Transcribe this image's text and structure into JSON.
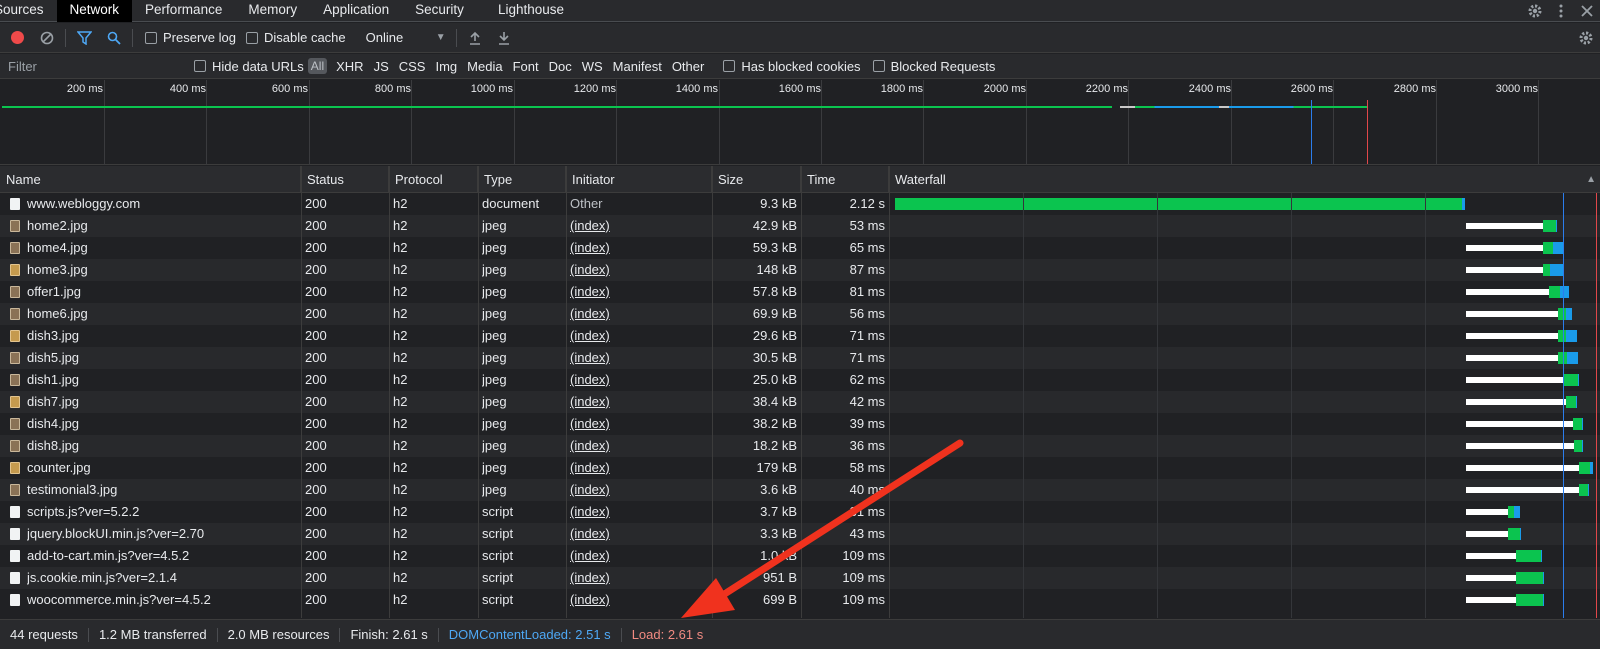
{
  "tabs": [
    {
      "label": "Sources",
      "active": false
    },
    {
      "label": "Network",
      "active": true
    },
    {
      "label": "Performance",
      "active": false
    },
    {
      "label": "Memory",
      "active": false
    },
    {
      "label": "Application",
      "active": false
    },
    {
      "label": "Security",
      "active": false
    },
    {
      "label": "Lighthouse",
      "active": false
    }
  ],
  "toolbar": {
    "preserve_log": "Preserve log",
    "disable_cache": "Disable cache",
    "throttle": "Online"
  },
  "filterbar": {
    "filter_placeholder": "Filter",
    "hide_data_urls": "Hide data URLs",
    "all": "All",
    "types": [
      "XHR",
      "JS",
      "CSS",
      "Img",
      "Media",
      "Font",
      "Doc",
      "WS",
      "Manifest",
      "Other"
    ],
    "has_blocked_cookies": "Has blocked cookies",
    "blocked_requests": "Blocked Requests"
  },
  "overview": {
    "ticks": [
      "200 ms",
      "400 ms",
      "600 ms",
      "800 ms",
      "1000 ms",
      "1200 ms",
      "1400 ms",
      "1600 ms",
      "1800 ms",
      "2000 ms",
      "2200 ms",
      "2400 ms",
      "2600 ms",
      "2800 ms",
      "3000 ms"
    ]
  },
  "table": {
    "headers": {
      "name": "Name",
      "status": "Status",
      "protocol": "Protocol",
      "type": "Type",
      "initiator": "Initiator",
      "size": "Size",
      "time": "Time",
      "waterfall": "Waterfall"
    },
    "rows": [
      {
        "name": "www.webloggy.com",
        "status": "200",
        "protocol": "h2",
        "type": "document",
        "initiator": "Other",
        "size": "9.3 kB",
        "time": "2.12 s",
        "icon": "doc-icon"
      },
      {
        "name": "home2.jpg",
        "status": "200",
        "protocol": "h2",
        "type": "jpeg",
        "initiator": "(index)",
        "size": "42.9 kB",
        "time": "53 ms",
        "icon": "image-icon"
      },
      {
        "name": "home4.jpg",
        "status": "200",
        "protocol": "h2",
        "type": "jpeg",
        "initiator": "(index)",
        "size": "59.3 kB",
        "time": "65 ms",
        "icon": "image-icon"
      },
      {
        "name": "home3.jpg",
        "status": "200",
        "protocol": "h2",
        "type": "jpeg",
        "initiator": "(index)",
        "size": "148 kB",
        "time": "87 ms",
        "icon": "image-icon"
      },
      {
        "name": "offer1.jpg",
        "status": "200",
        "protocol": "h2",
        "type": "jpeg",
        "initiator": "(index)",
        "size": "57.8 kB",
        "time": "81 ms",
        "icon": "image-icon"
      },
      {
        "name": "home6.jpg",
        "status": "200",
        "protocol": "h2",
        "type": "jpeg",
        "initiator": "(index)",
        "size": "69.9 kB",
        "time": "56 ms",
        "icon": "image-icon"
      },
      {
        "name": "dish3.jpg",
        "status": "200",
        "protocol": "h2",
        "type": "jpeg",
        "initiator": "(index)",
        "size": "29.6 kB",
        "time": "71 ms",
        "icon": "image-icon"
      },
      {
        "name": "dish5.jpg",
        "status": "200",
        "protocol": "h2",
        "type": "jpeg",
        "initiator": "(index)",
        "size": "30.5 kB",
        "time": "71 ms",
        "icon": "image-icon"
      },
      {
        "name": "dish1.jpg",
        "status": "200",
        "protocol": "h2",
        "type": "jpeg",
        "initiator": "(index)",
        "size": "25.0 kB",
        "time": "62 ms",
        "icon": "image-icon"
      },
      {
        "name": "dish7.jpg",
        "status": "200",
        "protocol": "h2",
        "type": "jpeg",
        "initiator": "(index)",
        "size": "38.4 kB",
        "time": "42 ms",
        "icon": "image-icon"
      },
      {
        "name": "dish4.jpg",
        "status": "200",
        "protocol": "h2",
        "type": "jpeg",
        "initiator": "(index)",
        "size": "38.2 kB",
        "time": "39 ms",
        "icon": "image-icon"
      },
      {
        "name": "dish8.jpg",
        "status": "200",
        "protocol": "h2",
        "type": "jpeg",
        "initiator": "(index)",
        "size": "18.2 kB",
        "time": "36 ms",
        "icon": "image-icon"
      },
      {
        "name": "counter.jpg",
        "status": "200",
        "protocol": "h2",
        "type": "jpeg",
        "initiator": "(index)",
        "size": "179 kB",
        "time": "58 ms",
        "icon": "image-icon"
      },
      {
        "name": "testimonial3.jpg",
        "status": "200",
        "protocol": "h2",
        "type": "jpeg",
        "initiator": "(index)",
        "size": "3.6 kB",
        "time": "40 ms",
        "icon": "image-icon"
      },
      {
        "name": "scripts.js?ver=5.2.2",
        "status": "200",
        "protocol": "h2",
        "type": "script",
        "initiator": "(index)",
        "size": "3.7 kB",
        "time": "31 ms",
        "icon": "doc-icon"
      },
      {
        "name": "jquery.blockUI.min.js?ver=2.70",
        "status": "200",
        "protocol": "h2",
        "type": "script",
        "initiator": "(index)",
        "size": "3.3 kB",
        "time": "43 ms",
        "icon": "doc-icon"
      },
      {
        "name": "add-to-cart.min.js?ver=4.5.2",
        "status": "200",
        "protocol": "h2",
        "type": "script",
        "initiator": "(index)",
        "size": "1.0 kB",
        "time": "109 ms",
        "icon": "doc-icon"
      },
      {
        "name": "js.cookie.min.js?ver=2.1.4",
        "status": "200",
        "protocol": "h2",
        "type": "script",
        "initiator": "(index)",
        "size": "951 B",
        "time": "109 ms",
        "icon": "doc-icon"
      },
      {
        "name": "woocommerce.min.js?ver=4.5.2",
        "status": "200",
        "protocol": "h2",
        "type": "script",
        "initiator": "(index)",
        "size": "699 B",
        "time": "109 ms",
        "icon": "doc-icon"
      }
    ]
  },
  "status": {
    "requests": "44 requests",
    "transferred": "1.2 MB transferred",
    "resources": "2.0 MB resources",
    "finish": "Finish: 2.61 s",
    "dcl": "DOMContentLoaded: 2.51 s",
    "load": "Load: 2.61 s"
  },
  "colors": {
    "record": "#ef4a4a",
    "dcl_line": "#2b7ded",
    "load_line": "#e1474a",
    "bar_receiving": "#0bc44f",
    "bar_blue": "#1a9bea",
    "annotation_arrow": "#f0321e"
  }
}
